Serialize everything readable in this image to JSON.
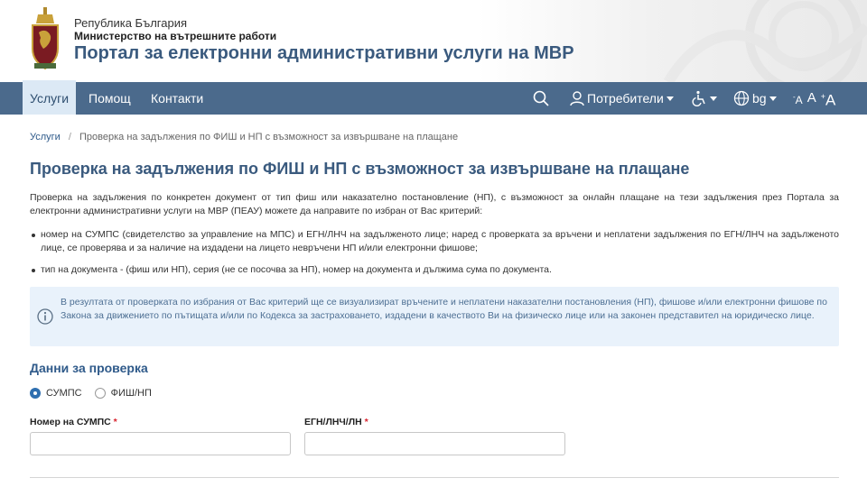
{
  "header": {
    "country": "Република България",
    "ministry": "Министерство на вътрешните работи",
    "portal_title": "Портал за електронни административни услуги на МВР"
  },
  "nav": {
    "items": [
      {
        "label": "Услуги",
        "active": true
      },
      {
        "label": "Помощ",
        "active": false
      },
      {
        "label": "Контакти",
        "active": false
      }
    ],
    "users_label": "Потребители",
    "language_label": "bg",
    "font_controls": [
      "A",
      "A",
      "A"
    ]
  },
  "breadcrumb": {
    "root": "Услуги",
    "separator": "/",
    "current": "Проверка на задължения по ФИШ и НП с възможност за извършване на плащане"
  },
  "page_title": "Проверка на задължения по ФИШ и НП с възможност за извършване на плащане",
  "intro": "Проверка на задължения по конкретен документ от тип фиш или наказателно постановление (НП), с възможност за онлайн плащане на тези задължения през Портала за електронни административни услуги на МВР (ПЕАУ) можете да направите по избран от Вас критерий:",
  "bullets": [
    "номер на СУМПС (свидетелство за управление на МПС) и ЕГН/ЛНЧ на задълженото лице;  наред с проверката за връчени и неплатени задължения по ЕГН/ЛНЧ на задълженото лице, се проверява и за наличие на издадени на лицето невръчени НП и/или електронни фишове;",
    "тип на документа - (фиш или НП), серия (не се посочва за НП), номер на документа и дължима сума по документа."
  ],
  "info": "В резултата от проверката по избрания от Вас критерий ще се визуализират връчените и неплатени наказателни постановления (НП), фишове и/или електронни фишове по Закона за движението по пътищата и/или по Кодекса за застраховането, издадени в качеството Ви на физическо лице или на законен представител на юридическо лице.",
  "form": {
    "section_title": "Данни за проверка",
    "radio_options": [
      {
        "label": "СУМПС",
        "checked": true
      },
      {
        "label": "ФИШ/НП",
        "checked": false
      }
    ],
    "fields": [
      {
        "label": "Номер на СУМПС",
        "required_mark": "*",
        "value": ""
      },
      {
        "label": "ЕГН/ЛНЧ/ЛН",
        "required_mark": "*",
        "value": ""
      }
    ]
  },
  "colors": {
    "nav_bg": "#4b6a8c",
    "title": "#3a5a7e",
    "accent": "#2f6fb0",
    "info_bg": "#e9f2fb",
    "required": "#d9232e"
  },
  "icons": {
    "crest": "coat-of-arms-icon",
    "search": "search-icon",
    "user": "user-icon",
    "accessibility": "wheelchair-icon",
    "language": "globe-icon",
    "info": "info-circle-icon"
  }
}
